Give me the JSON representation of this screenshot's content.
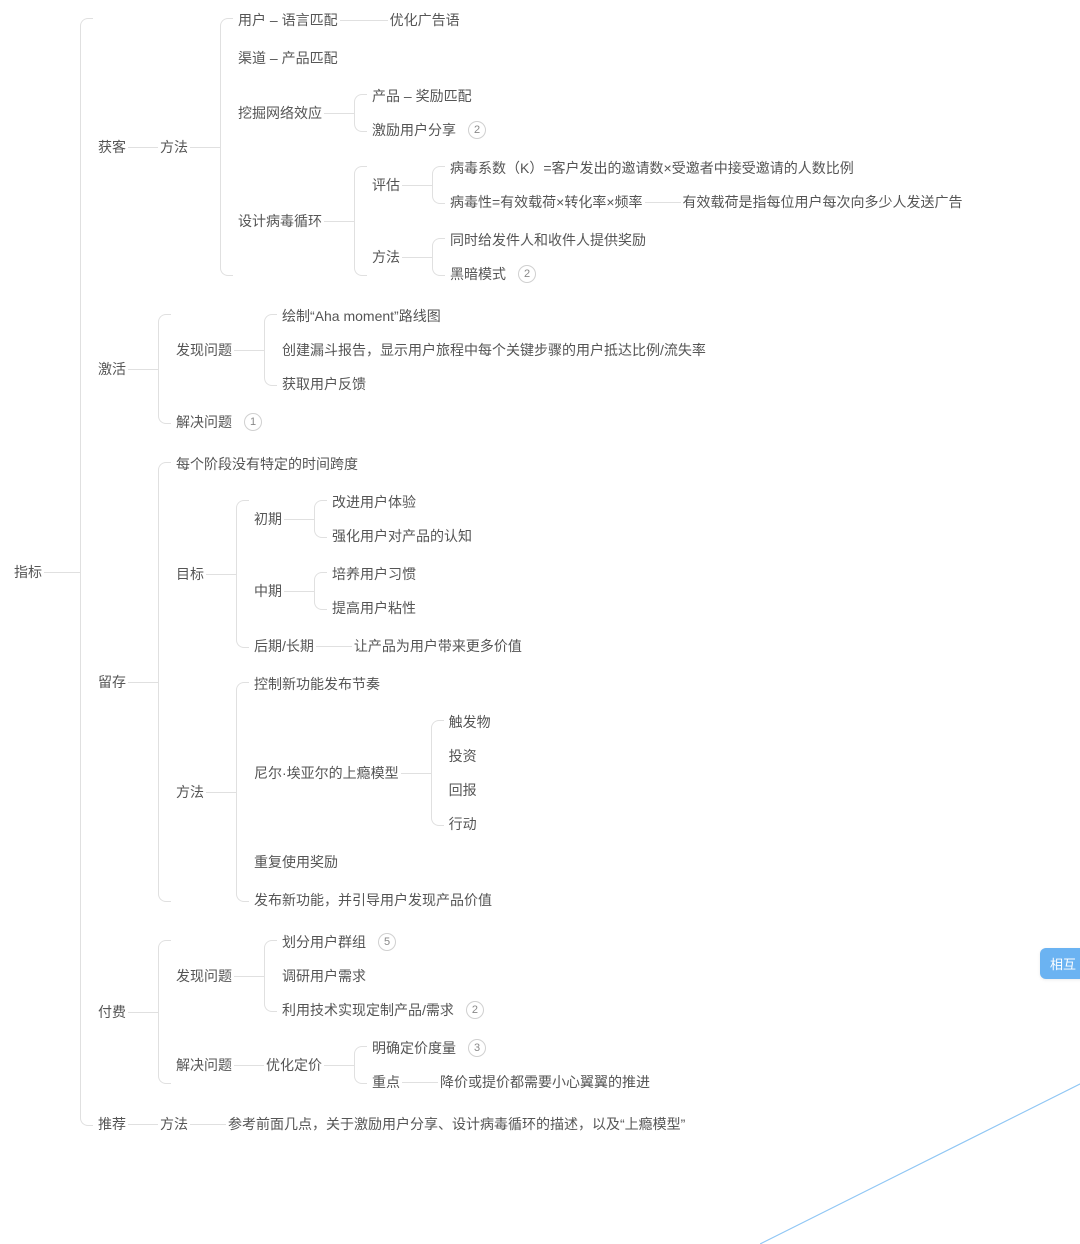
{
  "root": "指标",
  "blue_pill": "相互",
  "b1": {
    "name": "获客",
    "method": "方法",
    "c": [
      {
        "a": "用户 – 语言匹配",
        "b": "优化广告语"
      },
      {
        "a": "渠道 – 产品匹配"
      },
      {
        "a": "挖掘网络效应",
        "kids": [
          {
            "t": "产品 – 奖励匹配"
          },
          {
            "t": "激励用户分享",
            "badge": "2"
          }
        ]
      },
      {
        "a": "设计病毒循环",
        "eval_label": "评估",
        "eval": [
          {
            "t": "病毒系数（K）=客户发出的邀请数×受邀者中接受邀请的人数比例"
          },
          {
            "t": "病毒性=有效载荷×转化率×频率",
            "b": "有效载荷是指每位用户每次向多少人发送广告"
          }
        ],
        "method_label": "方法",
        "method": [
          {
            "t": "同时给发件人和收件人提供奖励"
          },
          {
            "t": "黑暗模式",
            "badge": "2"
          }
        ]
      }
    ]
  },
  "b2": {
    "name": "激活",
    "find_label": "发现问题",
    "find": [
      "绘制“Aha moment”路线图",
      "创建漏斗报告，显示用户旅程中每个关键步骤的用户抵达比例/流失率",
      "获取用户反馈"
    ],
    "solve_label": "解决问题",
    "solve_badge": "1"
  },
  "b3": {
    "name": "留存",
    "a": "每个阶段没有特定的时间跨度",
    "goals_label": "目标",
    "goals": {
      "early_label": "初期",
      "early": [
        "改进用户体验",
        "强化用户对产品的认知"
      ],
      "mid_label": "中期",
      "mid": [
        "培养用户习惯",
        "提高用户粘性"
      ],
      "late_label": "后期/长期",
      "late_text": "让产品为用户带来更多价值"
    },
    "methods_label": "方法",
    "methods": {
      "a": "控制新功能发布节奏",
      "model_label": "尼尔·埃亚尔的上瘾模型",
      "model": [
        "触发物",
        "投资",
        "回报",
        "行动"
      ],
      "c": "重复使用奖励",
      "d": "发布新功能，并引导用户发现产品价值"
    }
  },
  "b4": {
    "name": "付费",
    "find_label": "发现问题",
    "find": [
      {
        "t": "划分用户群组",
        "badge": "5"
      },
      {
        "t": "调研用户需求"
      },
      {
        "t": "利用技术实现定制产品/需求",
        "badge": "2"
      }
    ],
    "solve_label": "解决问题",
    "opt_label": "优化定价",
    "opt_a": {
      "t": "明确定价度量",
      "badge": "3"
    },
    "opt_focus_label": "重点",
    "opt_focus_text": "降价或提价都需要小心翼翼的推进"
  },
  "b5": {
    "name": "推荐",
    "method_label": "方法",
    "text": "参考前面几点，关于激励用户分享、设计病毒循环的描述，以及“上瘾模型”"
  }
}
